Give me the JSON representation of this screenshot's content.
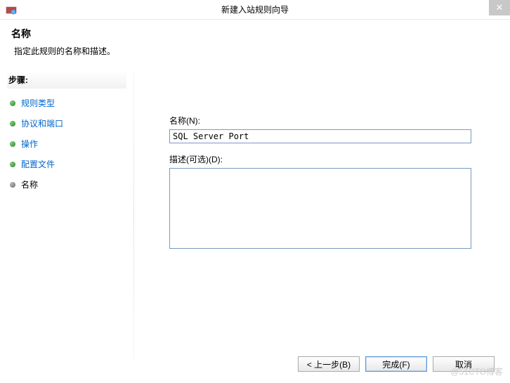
{
  "window": {
    "title": "新建入站规则向导"
  },
  "header": {
    "title": "名称",
    "subtitle": "指定此规则的名称和描述。"
  },
  "sidebar": {
    "stepsLabel": "步骤:",
    "steps": [
      {
        "label": "规则类型",
        "current": false
      },
      {
        "label": "协议和端口",
        "current": false
      },
      {
        "label": "操作",
        "current": false
      },
      {
        "label": "配置文件",
        "current": false
      },
      {
        "label": "名称",
        "current": true
      }
    ]
  },
  "form": {
    "nameLabel": "名称(N):",
    "nameValue": "SQL Server Port",
    "descLabel": "描述(可选)(D):",
    "descValue": ""
  },
  "buttons": {
    "back": "< 上一步(B)",
    "finish": "完成(F)",
    "cancel": "取消"
  },
  "watermark": "@51CTO博客"
}
